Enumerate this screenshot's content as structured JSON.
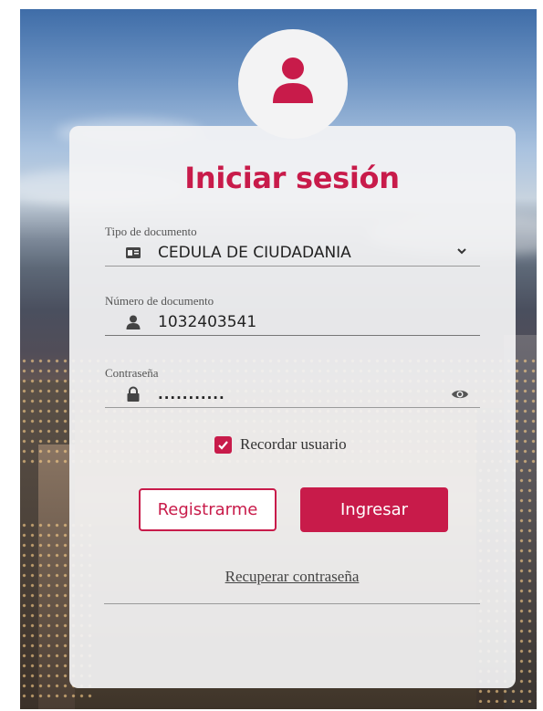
{
  "login": {
    "title": "Iniciar sesión",
    "brand_color": "#c81b4a",
    "document_type": {
      "label": "Tipo de documento",
      "value": "CEDULA DE CIUDADANIA",
      "icon": "id-card-icon"
    },
    "document_number": {
      "label": "Número de documento",
      "value": "1032403541",
      "icon": "user-icon"
    },
    "password": {
      "label": "Contraseña",
      "value": "...........",
      "icon": "lock-icon",
      "toggle_icon": "eye-icon"
    },
    "remember": {
      "label": "Recordar usuario",
      "checked": true
    },
    "register_label": "Registrarme",
    "login_label": "Ingresar",
    "recover_label": "Recuperar contraseña"
  }
}
